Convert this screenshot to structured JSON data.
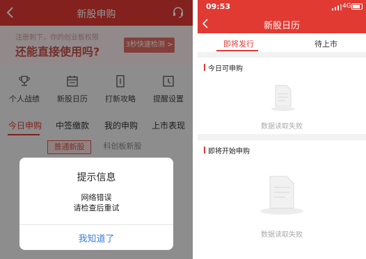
{
  "left": {
    "header": {
      "title": "新股申购"
    },
    "banner": {
      "subtitle": "注册刺下，你的创业板权限",
      "headline": "还能直接使用吗?",
      "cta": "3秒快速检测 >"
    },
    "quick_links": [
      {
        "label": "个人战绩",
        "icon": "trophy-icon"
      },
      {
        "label": "新股日历",
        "icon": "calendar-icon"
      },
      {
        "label": "打新攻略",
        "icon": "guide-icon"
      },
      {
        "label": "提醒设置",
        "icon": "reminder-icon"
      }
    ],
    "tabs": [
      "今日申购",
      "中签缴款",
      "我的申购",
      "上市表现"
    ],
    "active_tab": "今日申购",
    "subtabs": [
      "普通新股",
      "科创板新股"
    ],
    "active_subtab": "普通新股",
    "dialog": {
      "title": "提示信息",
      "message_line1": "网络错误",
      "message_line2": "请检查后重试",
      "button": "我知道了"
    }
  },
  "right": {
    "status": {
      "time": "09:53",
      "network": "4G"
    },
    "header": {
      "title": "新股日历"
    },
    "tabs": [
      "即将发行",
      "待上市"
    ],
    "active_tab": "即将发行",
    "sections": [
      {
        "title": "今日可申购",
        "empty_text": "数据读取失败"
      },
      {
        "title": "即将开始申购",
        "empty_text": "数据读取失败"
      }
    ]
  },
  "colors": {
    "brand_red": "#e03a33",
    "link_blue": "#3b7dd8"
  }
}
